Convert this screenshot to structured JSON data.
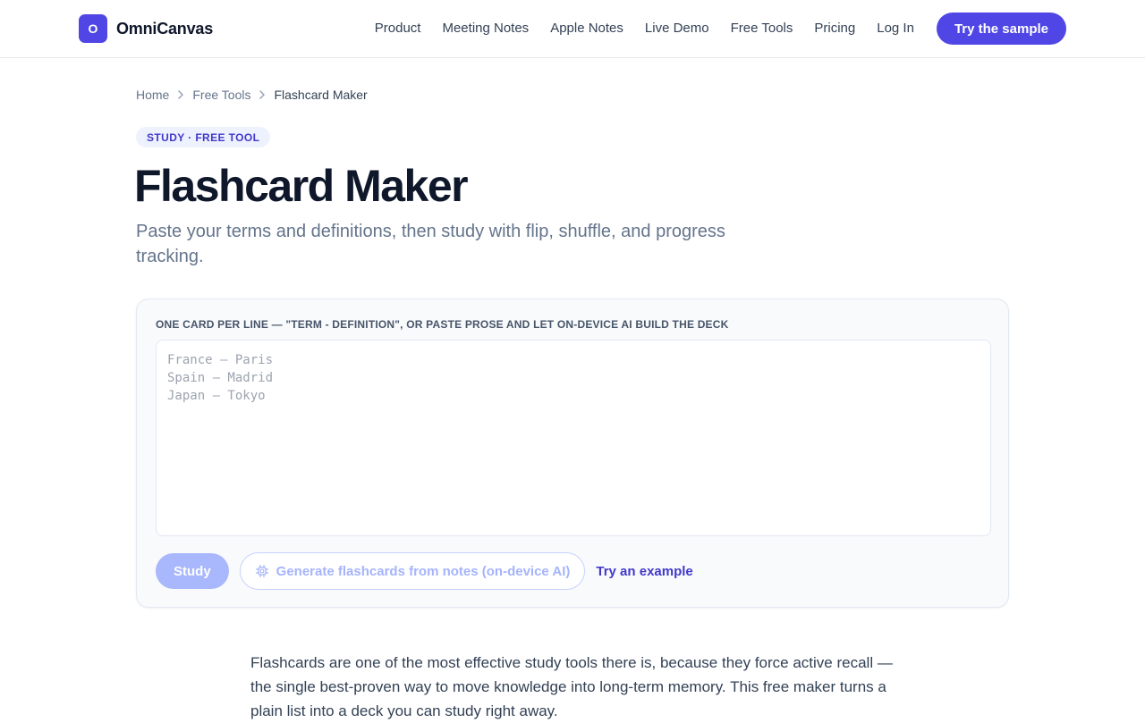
{
  "header": {
    "logo_letter": "O",
    "brand": "OmniCanvas",
    "nav": [
      "Product",
      "Meeting Notes",
      "Apple Notes",
      "Live Demo",
      "Free Tools",
      "Pricing",
      "Log In"
    ],
    "cta": "Try the sample"
  },
  "breadcrumb": {
    "items": [
      "Home",
      "Free Tools"
    ],
    "current": "Flashcard Maker"
  },
  "hero": {
    "pill": "STUDY · FREE TOOL",
    "title": "Flashcard Maker",
    "subtitle": "Paste your terms and definitions, then study with flip, shuffle, and progress tracking."
  },
  "tool": {
    "label": "ONE CARD PER LINE — \"TERM - DEFINITION\", OR PASTE PROSE AND LET ON-DEVICE AI BUILD THE DECK",
    "placeholder_lines": [
      "France – Paris",
      "Spain – Madrid",
      "Japan – Tokyo"
    ],
    "study_button": "Study",
    "generate_button": "Generate flashcards from notes (on-device AI)",
    "example_link": "Try an example"
  },
  "content": {
    "paragraph": "Flashcards are one of the most effective study tools there is, because they force active recall — the single best-proven way to move knowledge into long-term memory. This free maker turns a plain list into a deck you can study right away."
  },
  "colors": {
    "accent": "#4f46e5",
    "accent_light": "#a5b4fc",
    "pill_bg": "#eef2ff"
  }
}
